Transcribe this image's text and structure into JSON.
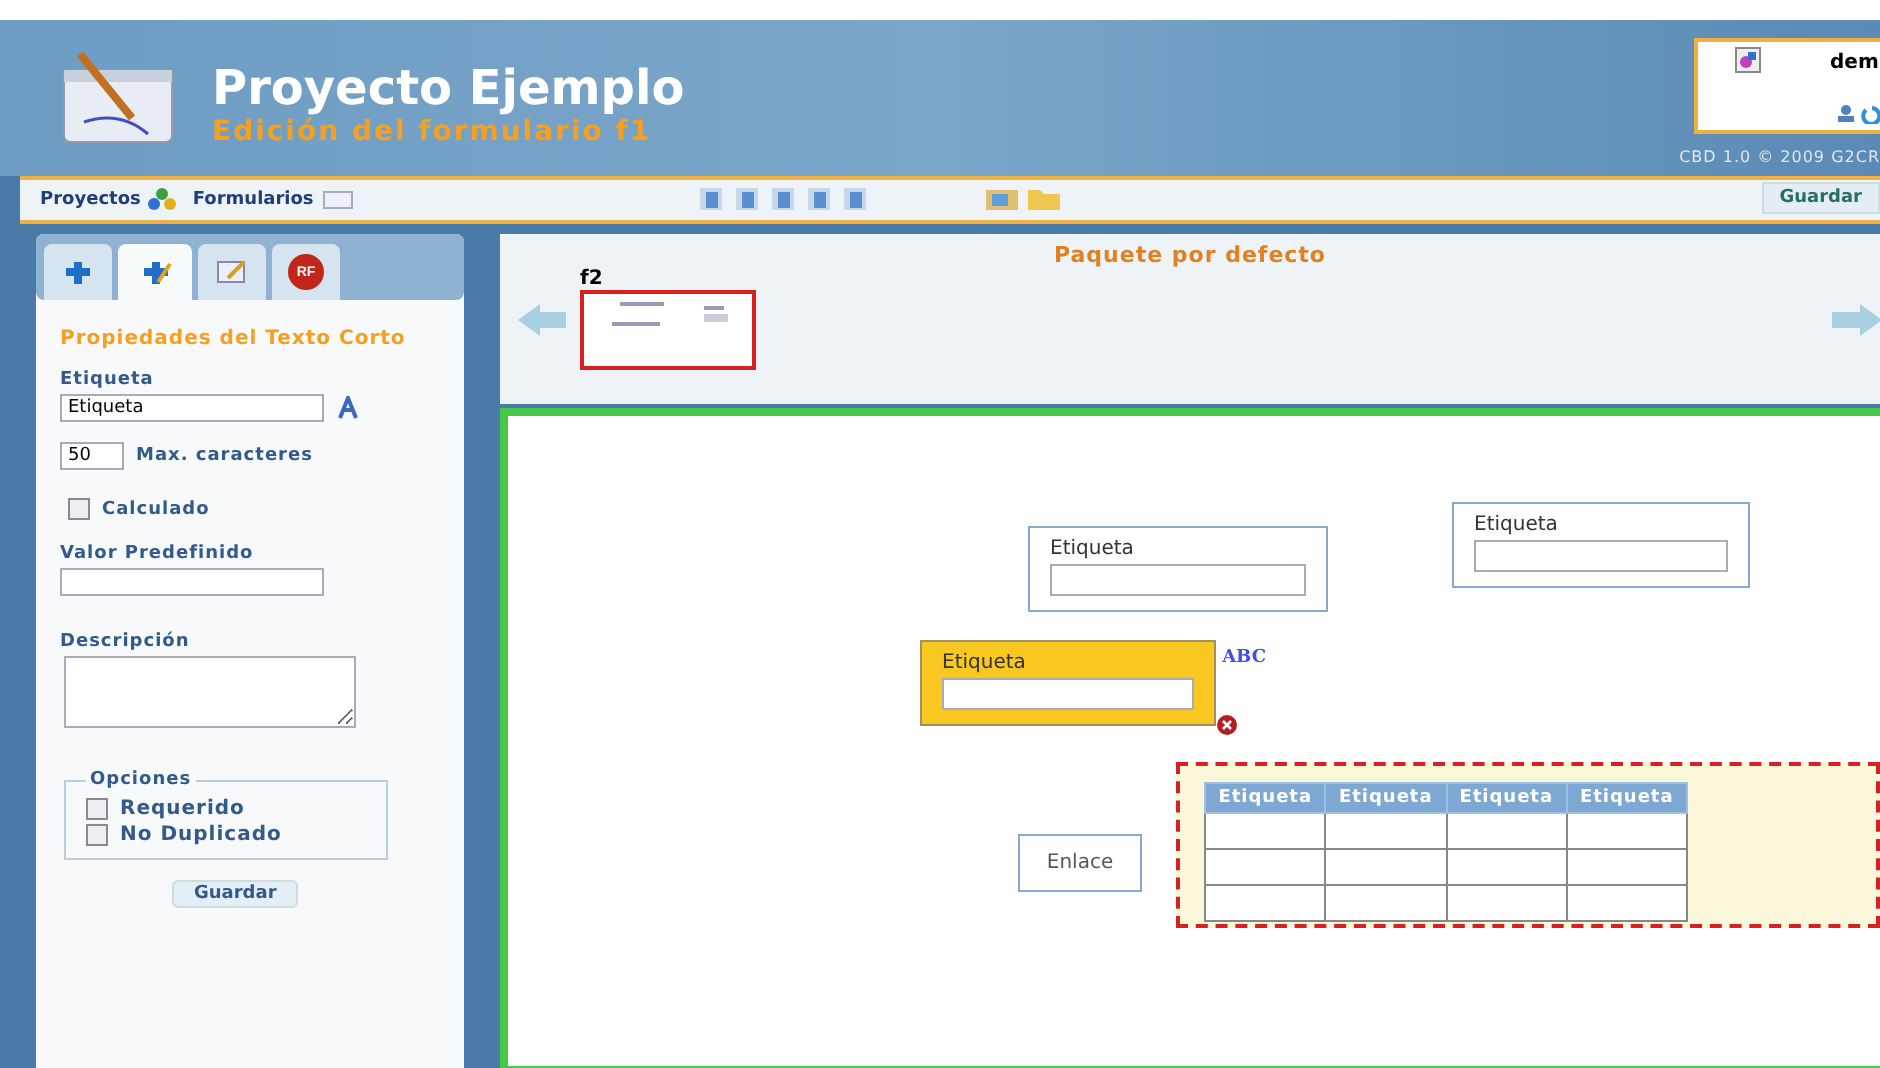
{
  "header": {
    "title": "Proyecto Ejemplo",
    "subtitle": "Edición del formulario f1",
    "user": "dem",
    "copyright": "CBD 1.0 © 2009 G2CR"
  },
  "toolbar": {
    "items": [
      {
        "label": "Proyectos"
      },
      {
        "label": "Formularios"
      }
    ],
    "save": "Guardar"
  },
  "panel": {
    "tabs": [
      {
        "selected": false
      },
      {
        "selected": true
      },
      {
        "selected": false
      },
      {
        "selected": false,
        "text": "RF"
      }
    ],
    "heading": "Propiedades del Texto Corto",
    "label_caption": "Etiqueta",
    "label_value": "Etiqueta",
    "max_value": "50",
    "max_caption": "Max. caracteres",
    "calculated": {
      "label": "Calculado",
      "checked": false
    },
    "default_caption": "Valor Predefinido",
    "description_caption": "Descripción",
    "options": {
      "legend": "Opciones",
      "items": [
        {
          "label": "Requerido",
          "checked": false
        },
        {
          "label": "No Duplicado",
          "checked": false
        }
      ]
    },
    "save": "Guardar"
  },
  "package": {
    "title": "Paquete por defecto",
    "forms": [
      {
        "name": "f2",
        "selected": true
      }
    ]
  },
  "canvas": {
    "widgets": [
      {
        "kind": "field",
        "label": "Etiqueta",
        "selected": false
      },
      {
        "kind": "field",
        "label": "Etiqueta",
        "selected": false
      },
      {
        "kind": "field",
        "label": "Etiqueta",
        "selected": true,
        "badge": "ABC"
      },
      {
        "kind": "link",
        "label": "Enlace"
      },
      {
        "kind": "table",
        "selected": true,
        "columns": [
          "Etiqueta",
          "Etiqueta",
          "Etiqueta",
          "Etiqueta"
        ]
      }
    ]
  }
}
